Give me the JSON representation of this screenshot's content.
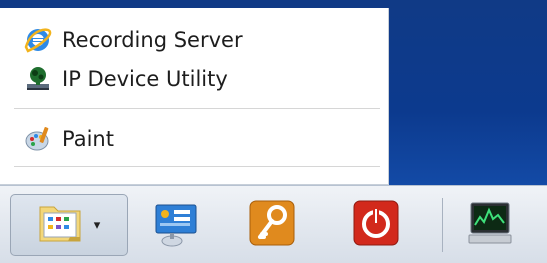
{
  "menu": {
    "items": [
      {
        "label": "Recording Server",
        "icon": "internet-explorer-icon"
      },
      {
        "label": "IP Device Utility",
        "icon": "ip-device-utility-icon"
      },
      {
        "label": "Paint",
        "icon": "paint-icon"
      }
    ]
  },
  "taskbar": {
    "buttons": [
      {
        "icon": "explorer-folder-icon",
        "state": "active",
        "has_dropdown": true
      },
      {
        "icon": "network-config-icon"
      },
      {
        "icon": "key-icon"
      },
      {
        "icon": "power-icon"
      },
      {
        "icon": "monitor-activity-icon"
      }
    ],
    "dropdown_glyph": "▾"
  },
  "colors": {
    "desktop": "#0c3a8e",
    "key_tile": "#e08a1e",
    "power_tile": "#d2291c"
  }
}
